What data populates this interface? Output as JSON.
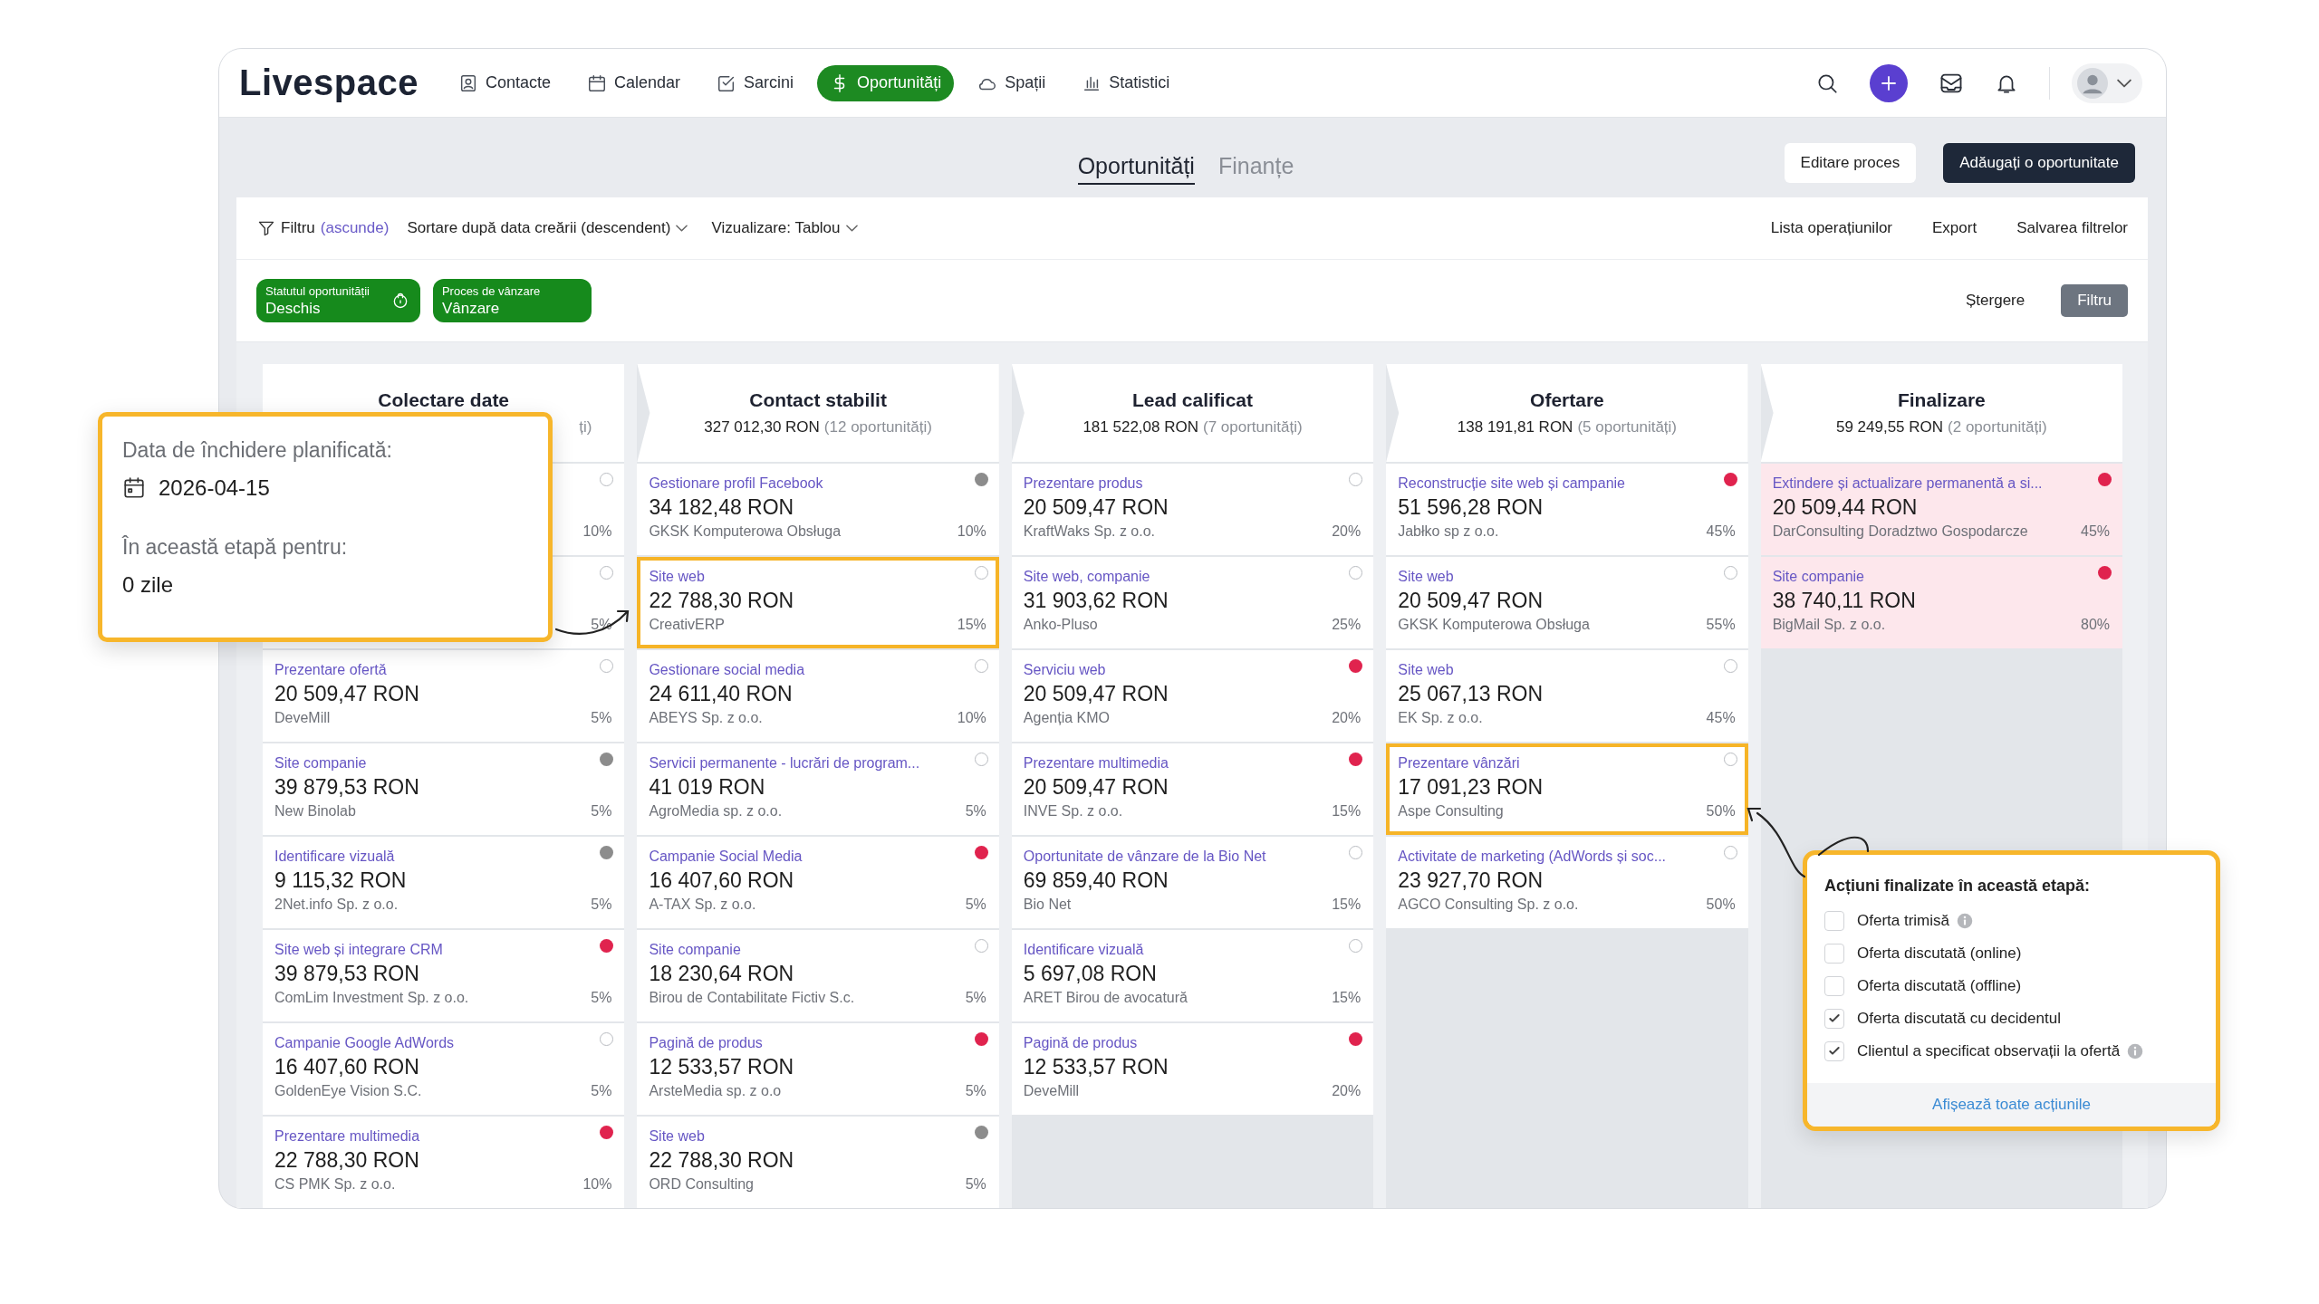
{
  "nav": {
    "logo": "Livespace",
    "items": [
      {
        "label": "Contacte",
        "selected": false
      },
      {
        "label": "Calendar",
        "selected": false
      },
      {
        "label": "Sarcini",
        "selected": false
      },
      {
        "label": "Oportunități",
        "selected": true
      },
      {
        "label": "Spații",
        "selected": false
      },
      {
        "label": "Statistici",
        "selected": false
      }
    ]
  },
  "page_tabs": [
    {
      "label": "Oportunități",
      "selected": true
    },
    {
      "label": "Finanțe",
      "selected": false
    }
  ],
  "buttons": [
    {
      "label": "Editare proces",
      "kind": "secondary"
    },
    {
      "label": "Adăugați o oportunitate",
      "kind": "primary"
    }
  ],
  "filter_bar": {
    "filter_label": "Filtru",
    "hide_link": "(ascunde)",
    "sort": "Sortare după data creării (descendent)",
    "view": "Vizualizare: Tablou",
    "actions": [
      "Lista operațiunilor",
      "Export",
      "Salvarea filtrelor"
    ]
  },
  "chips": [
    {
      "label": "Statutul oportunității",
      "value": "Deschis",
      "locked": true
    },
    {
      "label": "Proces de vânzare",
      "value": "Vânzare",
      "locked": false
    }
  ],
  "clear_label": "Ștergere",
  "apply_label": "Filtru",
  "columns": [
    {
      "title": "Colectare date",
      "count": "ți)",
      "cards": [
        {
          "probability": "10%",
          "highlighted": false,
          "alert": false
        },
        {
          "probability": "5%",
          "highlighted": false,
          "alert": false
        },
        {
          "title": "Prezentare ofertă",
          "amount": "20 509,47 RON",
          "company": "DeveMill",
          "probability": "5%",
          "highlighted": false,
          "alert": false
        },
        {
          "title": "Site companie",
          "amount": "39 879,53 RON",
          "company": "New Binolab",
          "probability": "5%",
          "color": "#8c8c8c",
          "highlighted": false,
          "alert": false
        },
        {
          "title": "Identificare vizuală",
          "amount": "9 115,32 RON",
          "company": "2Net.info Sp. z o.o.",
          "probability": "5%",
          "color": "#8c8c8c",
          "highlighted": false,
          "alert": false
        },
        {
          "title": "Site web și integrare CRM",
          "amount": "39 879,53 RON",
          "company": "ComLim Investment Sp. z o.o.",
          "probability": "5%",
          "color": "#e0234e",
          "highlighted": false,
          "alert": false
        },
        {
          "title": "Campanie Google AdWords",
          "amount": "16 407,60 RON",
          "company": "GoldenEye Vision S.C.",
          "probability": "5%",
          "highlighted": false,
          "alert": false
        },
        {
          "title": "Prezentare multimedia",
          "amount": "22 788,30 RON",
          "company": "CS PMK Sp. z o.o.",
          "probability": "10%",
          "color": "#e0234e",
          "highlighted": false,
          "alert": false
        }
      ]
    },
    {
      "title": "Contact stabilit",
      "total": "327 012,30 RON",
      "count": "(12 oportunități)",
      "cards": [
        {
          "title": "Gestionare profil Facebook",
          "amount": "34 182,48 RON",
          "company": "GKSK Komputerowa Obsługa",
          "probability": "10%",
          "color": "#8c8c8c",
          "highlighted": false,
          "alert": false
        },
        {
          "title": "Site web",
          "amount": "22 788,30 RON",
          "company": "CreativERP",
          "probability": "15%",
          "highlighted": true,
          "alert": false
        },
        {
          "title": "Gestionare social media",
          "amount": "24 611,40 RON",
          "company": "ABEYS Sp. z o.o.",
          "probability": "10%",
          "highlighted": false,
          "alert": false
        },
        {
          "title": "Servicii permanente - lucrări de program...",
          "amount": "41 019 RON",
          "company": "AgroMedia sp. z o.o.",
          "probability": "5%",
          "highlighted": false,
          "alert": false
        },
        {
          "title": "Campanie Social Media",
          "amount": "16 407,60 RON",
          "company": "A-TAX Sp. z o.o.",
          "probability": "5%",
          "color": "#e0234e",
          "highlighted": false,
          "alert": false
        },
        {
          "title": "Site companie",
          "amount": "18 230,64 RON",
          "company": "Birou de Contabilitate Fictiv S.c.",
          "probability": "5%",
          "highlighted": false,
          "alert": false
        },
        {
          "title": "Pagină de produs",
          "amount": "12 533,57 RON",
          "company": "ArsteMedia sp. z o.o",
          "probability": "5%",
          "color": "#e0234e",
          "highlighted": false,
          "alert": false
        },
        {
          "title": "Site web",
          "amount": "22 788,30 RON",
          "company": "ORD Consulting",
          "probability": "5%",
          "color": "#8c8c8c",
          "highlighted": false,
          "alert": false
        }
      ]
    },
    {
      "title": "Lead calificat",
      "total": "181 522,08 RON",
      "count": "(7 oportunități)",
      "cards": [
        {
          "title": "Prezentare produs",
          "amount": "20 509,47 RON",
          "company": "KraftWaks Sp. z o.o.",
          "probability": "20%",
          "highlighted": false,
          "alert": false
        },
        {
          "title": "Site web, companie",
          "amount": "31 903,62 RON",
          "company": "Anko-Pluso",
          "probability": "25%",
          "highlighted": false,
          "alert": false
        },
        {
          "title": "Serviciu web",
          "amount": "20 509,47 RON",
          "company": "Agenția KMO",
          "probability": "20%",
          "color": "#e0234e",
          "highlighted": false,
          "alert": false
        },
        {
          "title": "Prezentare multimedia",
          "amount": "20 509,47 RON",
          "company": "INVE Sp. z o.o.",
          "probability": "15%",
          "color": "#e0234e",
          "highlighted": false,
          "alert": false
        },
        {
          "title": "Oportunitate de vânzare de la Bio Net",
          "amount": "69 859,40 RON",
          "company": "Bio Net",
          "probability": "15%",
          "highlighted": false,
          "alert": false
        },
        {
          "title": "Identificare vizuală",
          "amount": "5 697,08 RON",
          "company": "ARET Birou de avocatură",
          "probability": "15%",
          "highlighted": false,
          "alert": false
        },
        {
          "title": "Pagină de produs",
          "amount": "12 533,57 RON",
          "company": "DeveMill",
          "probability": "20%",
          "color": "#e0234e",
          "highlighted": false,
          "alert": false
        }
      ]
    },
    {
      "title": "Ofertare",
      "total": "138 191,81 RON",
      "count": "(5 oportunități)",
      "cards": [
        {
          "title": "Reconstrucție site web și campanie",
          "amount": "51 596,28 RON",
          "company": "Jabłko sp z o.o.",
          "probability": "45%",
          "color": "#e0234e",
          "highlighted": false,
          "alert": false
        },
        {
          "title": "Site web",
          "amount": "20 509,47 RON",
          "company": "GKSK Komputerowa Obsługa",
          "probability": "55%",
          "highlighted": false,
          "alert": false
        },
        {
          "title": "Site web",
          "amount": "25 067,13 RON",
          "company": "EK Sp. z o.o.",
          "probability": "45%",
          "highlighted": false,
          "alert": false
        },
        {
          "title": "Prezentare vânzări",
          "amount": "17 091,23 RON",
          "company": "Aspe Consulting",
          "probability": "50%",
          "highlighted": true,
          "alert": false
        },
        {
          "title": "Activitate de marketing (AdWords și soc...",
          "amount": "23 927,70 RON",
          "company": "AGCO Consulting Sp. z o.o.",
          "probability": "50%",
          "highlighted": false,
          "alert": false
        }
      ]
    },
    {
      "title": "Finalizare",
      "total": "59 249,55 RON",
      "count": "(2 oportunități)",
      "cards": [
        {
          "title": "Extindere și actualizare permanentă a si...",
          "amount": "20 509,44 RON",
          "company": "DarConsulting Doradztwo Gospodarcze",
          "probability": "45%",
          "color": "#e0234e",
          "highlighted": false,
          "alert": true
        },
        {
          "title": "Site companie",
          "amount": "38 740,11 RON",
          "company": "BigMail Sp. z o.o.",
          "probability": "80%",
          "color": "#e0234e",
          "highlighted": false,
          "alert": true
        }
      ]
    }
  ],
  "date_callout": {
    "label": "Data de închidere planificată:",
    "date": "2026-04-15",
    "duration_label": "În această etapă pentru:",
    "duration": "0 zile"
  },
  "actions_callout": {
    "title": "Acțiuni finalizate în această etapă:",
    "items": [
      {
        "label": "Oferta trimisă",
        "checked": false,
        "info": true
      },
      {
        "label": "Oferta discutată (online)",
        "checked": false,
        "info": false
      },
      {
        "label": "Oferta discutată (offline)",
        "checked": false,
        "info": false
      },
      {
        "label": "Oferta discutată cu decidentul",
        "checked": true,
        "info": false
      },
      {
        "label": "Clientul a specificat observații la ofertă",
        "checked": true,
        "info": true
      }
    ],
    "link": "Afișează toate acțiunile"
  }
}
